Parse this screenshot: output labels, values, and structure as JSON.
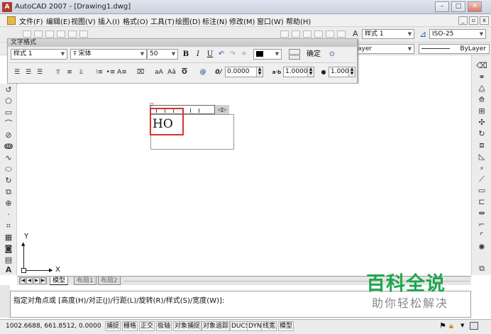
{
  "window": {
    "title": "AutoCAD 2007 - [Drawing1.dwg]",
    "app_icon": "A"
  },
  "menu": [
    "文件(F)",
    "编辑(E)",
    "视图(V)",
    "插入(I)",
    "格式(O)",
    "工具(T)",
    "绘图(D)",
    "标注(N)",
    "修改(M)",
    "窗口(W)",
    "帮助(H)"
  ],
  "styles_toolbar": {
    "text_style": "样式 1",
    "dim_style": "ISO-25"
  },
  "layer_toolbar": {
    "layer": "ayer",
    "linetype": "ByLayer"
  },
  "text_format": {
    "title": "文字格式",
    "style": "样式 1",
    "font": "宋体",
    "height": "50",
    "bold": "B",
    "italic": "I",
    "underline": "U",
    "undo": "↶",
    "redo": "↷",
    "ok": "确定",
    "uppercase": "aA",
    "lowercase": "Aā",
    "symbol": "@",
    "oblique_value": "0.0000",
    "tracking_value": "1.0000",
    "width_value": "1.0000",
    "oblique_icon": "0/",
    "tracking_icon": "a·b",
    "width_icon": "●"
  },
  "canvas": {
    "mtext": "HO",
    "axis_x": "X",
    "axis_y": "Y"
  },
  "tabs": {
    "model": "模型",
    "layout1": "布局1",
    "layout2": "布局2"
  },
  "command": {
    "prompt": "指定对角点或 [高度(H)/对正(J)/行距(L)/旋转(R)/样式(S)/宽度(W)]:"
  },
  "status": {
    "coords": "1002.6688, 661.8512, 0.0000",
    "buttons": [
      "捕捉",
      "栅格",
      "正交",
      "极轴",
      "对象捕捉",
      "对象追踪",
      "DUCS",
      "DYN",
      "线宽",
      "模型"
    ]
  },
  "watermark": {
    "title": "百科全说",
    "subtitle": "助你轻松解决"
  },
  "colors": {
    "accent_red": "#d93030",
    "watermark_green": "#1ea74d"
  }
}
